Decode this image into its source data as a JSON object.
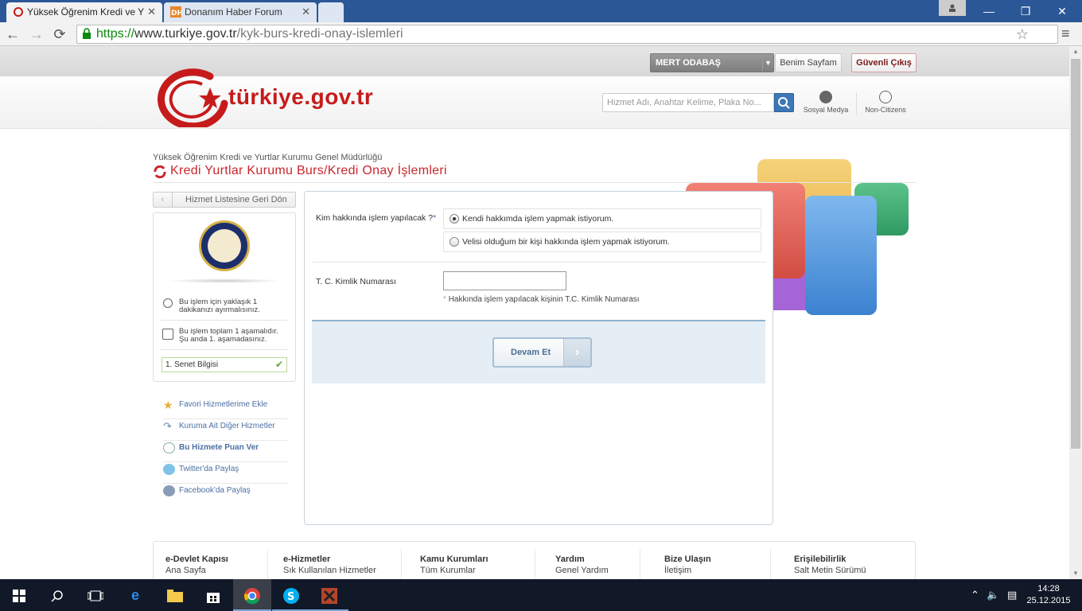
{
  "browser": {
    "tabs": [
      {
        "title": "Yüksek Öğrenim Kredi ve Y",
        "active": true
      },
      {
        "title": "Donanım Haber Forum",
        "active": false
      }
    ],
    "url_scheme": "https://",
    "url_host": "www.turkiye.gov.tr",
    "url_path": "/kyk-burs-kredi-onay-islemleri"
  },
  "topbar": {
    "username": "MERT ODABAŞ",
    "my_page": "Benim Sayfam",
    "logout": "Güvenli Çıkış"
  },
  "header": {
    "logo_text": "türkiye.gov.tr",
    "search_placeholder": "Hizmet Adı, Anahtar Kelime, Plaka No...",
    "social_label": "Sosyal Medya",
    "noncitizens_label": "Non-Citizens"
  },
  "page": {
    "org": "Yüksek Öğrenim Kredi ve Yurtlar Kurumu Genel Müdürlüğü",
    "title": "Kredi Yurtlar Kurumu Burs/Kredi Onay İşlemleri"
  },
  "sidebar": {
    "back": "Hizmet Listesine Geri Dön",
    "time_info": [
      "Bu işlem için yaklaşık 1",
      "dakikanızı ayırmalısınız."
    ],
    "step_info": [
      "Bu işlem toplam 1 aşamalıdır.",
      "Şu anda 1. aşamadasınız."
    ],
    "current_step": "1. Senet Bilgisi",
    "links": [
      {
        "label": "Favori Hizmetlerime Ekle",
        "bold": false
      },
      {
        "label": "Kuruma Ait Diğer Hizmetler",
        "bold": false
      },
      {
        "label": "Bu Hizmete Puan Ver",
        "bold": true
      },
      {
        "label": "Twitter'da Paylaş",
        "bold": false
      },
      {
        "label": "Facebook'da Paylaş",
        "bold": false
      }
    ]
  },
  "form": {
    "question": "Kim hakkında işlem yapılacak ?",
    "required_mark": "*",
    "options": [
      {
        "label": "Kendi hakkımda işlem yapmak istiyorum.",
        "selected": true
      },
      {
        "label": "Velisi olduğum bir kişi hakkında işlem yapmak istiyorum.",
        "selected": false
      }
    ],
    "tc_label": "T. C. Kimlik Numarası",
    "tc_value": "",
    "tc_hint_mark": "*",
    "tc_hint": "Hakkında işlem yapılacak kişinin T.C. Kimlik Numarası",
    "submit": "Devam Et"
  },
  "footer": {
    "columns": [
      {
        "heading": "e-Devlet Kapısı",
        "sub": "Ana Sayfa"
      },
      {
        "heading": "e-Hizmetler",
        "sub": "Sık Kullanılan Hizmetler"
      },
      {
        "heading": "Kamu Kurumları",
        "sub": "Tüm Kurumlar"
      },
      {
        "heading": "Yardım",
        "sub": "Genel Yardım"
      },
      {
        "heading": "Bize Ulaşın",
        "sub": "İletişim"
      },
      {
        "heading": "Erişilebilirlik",
        "sub": "Salt Metin Sürümü"
      }
    ]
  },
  "taskbar": {
    "time": "14:28",
    "date": "25.12.2015"
  },
  "colors": {
    "brand_red": "#c8272d",
    "link_blue": "#4b6fa3",
    "taskbar": "#111827"
  }
}
